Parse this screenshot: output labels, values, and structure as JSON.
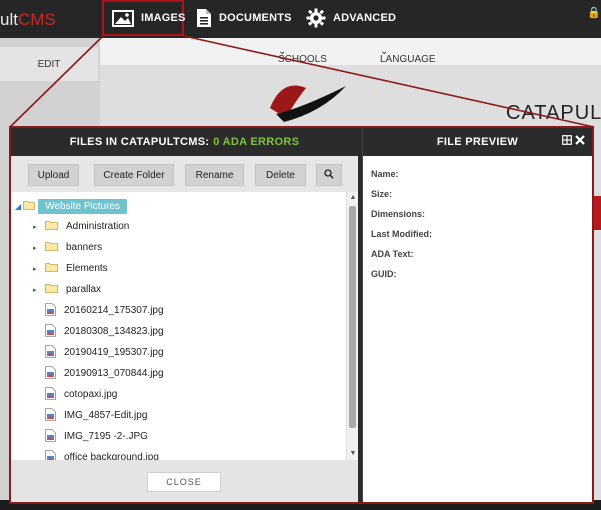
{
  "topbar": {
    "brand_prefix": "ult",
    "brand_suffix": "CMS",
    "nav": [
      {
        "label": "IMAGES",
        "icon": "image-icon"
      },
      {
        "label": "DOCUMENTS",
        "icon": "document-icon"
      },
      {
        "label": "ADVANCED",
        "icon": "gear-icon"
      }
    ]
  },
  "site": {
    "edit_label": "EDIT",
    "nav_schools": "SCHOOLS",
    "nav_language": "LANGUAGE",
    "title_partial": "CATAPUL",
    "colors": {
      "accent": "#b7191f",
      "selection": "#6fc3cf",
      "ok": "#7fc23a"
    }
  },
  "files_panel": {
    "title": "FILES IN CATAPULTCMS:",
    "status": "0 ADA ERRORS",
    "toolbar": {
      "upload": "Upload",
      "create_folder": "Create Folder",
      "rename": "Rename",
      "delete": "Delete",
      "search_icon": "search-icon"
    },
    "root": "Website Pictures",
    "folders": [
      "Administration",
      "banners",
      "Elements",
      "parallax"
    ],
    "files": [
      "20160214_175307.jpg",
      "20180308_134823.jpg",
      "20190419_195307.jpg",
      "20190913_070844.jpg",
      "cotopaxi.jpg",
      "IMG_4857-Edit.jpg",
      "IMG_7195 -2-.JPG",
      "office background.jpg"
    ],
    "close_label": "CLOSE"
  },
  "preview_panel": {
    "title": "FILE PREVIEW",
    "properties": [
      "Name:",
      "Size:",
      "Dimensions:",
      "Last Modified:",
      "ADA Text:",
      "GUID:"
    ]
  }
}
